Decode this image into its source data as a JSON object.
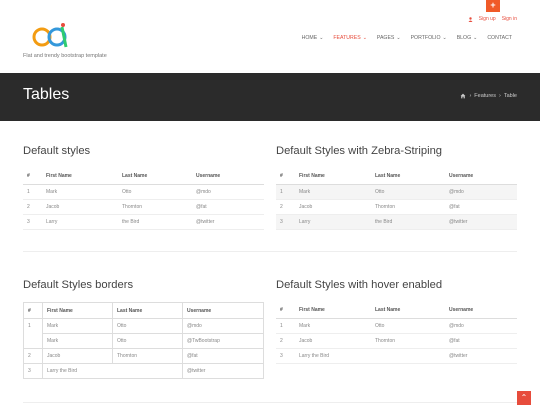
{
  "topbar": {
    "plus": "+",
    "sign_up": "Sign up",
    "sign_in": "Sign in"
  },
  "brand": {
    "tagline": "Flat and trendy bootstrap template"
  },
  "nav": [
    {
      "label": "HOME",
      "active": false
    },
    {
      "label": "FEATURES",
      "active": true
    },
    {
      "label": "PAGES",
      "active": false
    },
    {
      "label": "PORTFOLIO",
      "active": false
    },
    {
      "label": "BLOG",
      "active": false
    },
    {
      "label": "CONTACT",
      "active": false
    }
  ],
  "banner": {
    "title": "Tables",
    "crumb_1": "Features",
    "crumb_2": "Table"
  },
  "sections": {
    "default": {
      "title": "Default styles",
      "headers": [
        "#",
        "First Name",
        "Last Name",
        "Username"
      ],
      "rows": [
        [
          "1",
          "Mark",
          "Otto",
          "@mdo"
        ],
        [
          "2",
          "Jacob",
          "Thornton",
          "@fat"
        ],
        [
          "3",
          "Larry",
          "the Bird",
          "@twitter"
        ]
      ]
    },
    "zebra": {
      "title": "Default Styles with Zebra-Striping",
      "headers": [
        "#",
        "First Name",
        "Last Name",
        "Username"
      ],
      "rows": [
        [
          "1",
          "Mark",
          "Otto",
          "@mdo"
        ],
        [
          "2",
          "Jacob",
          "Thornton",
          "@fat"
        ],
        [
          "3",
          "Larry",
          "the Bird",
          "@twitter"
        ]
      ]
    },
    "borders": {
      "title": "Default Styles borders",
      "headers": [
        "#",
        "First Name",
        "Last Name",
        "Username"
      ],
      "rows": [
        [
          "1",
          "Mark",
          "Otto",
          "@mdo"
        ],
        [
          "",
          "Mark",
          "Otto",
          "@TwBootstrap"
        ],
        [
          "2",
          "Jacob",
          "Thornton",
          "@fat"
        ],
        [
          "3",
          "Larry the Bird",
          "",
          "@twitter"
        ]
      ]
    },
    "hover": {
      "title": "Default Styles with hover enabled",
      "headers": [
        "#",
        "First Name",
        "Last Name",
        "Username"
      ],
      "rows": [
        [
          "1",
          "Mark",
          "Otto",
          "@mdo"
        ],
        [
          "2",
          "Jacob",
          "Thornton",
          "@fat"
        ],
        [
          "3",
          "Larry the Bird",
          "",
          "@twitter"
        ]
      ]
    }
  },
  "colors": {
    "accent": "#e74c3c",
    "banner": "#2b2b2b"
  },
  "icons": {
    "home": "home-icon",
    "user": "user-icon",
    "back_to_top": "chevron-up-icon"
  }
}
